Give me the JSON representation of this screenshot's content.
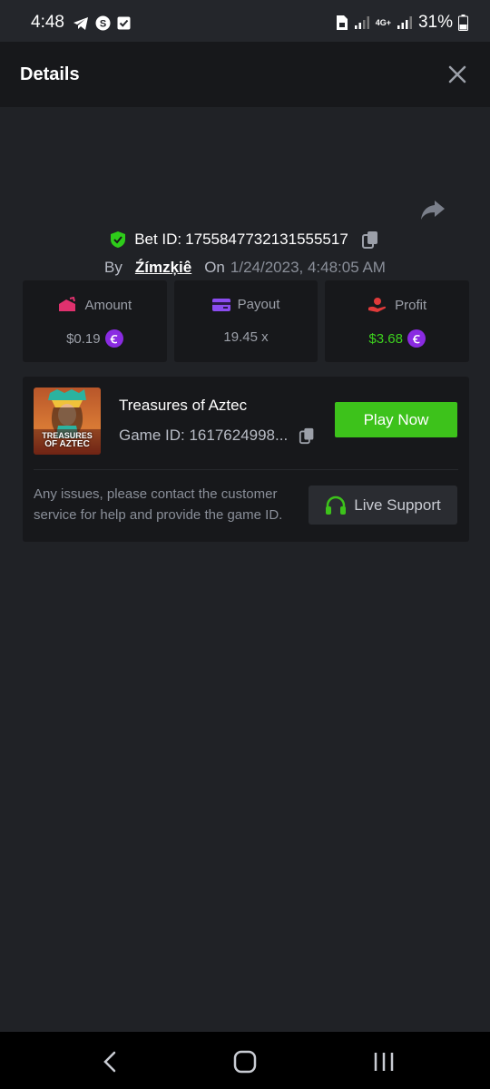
{
  "status_bar": {
    "time": "4:48",
    "battery": "31%",
    "network": "4G+"
  },
  "header": {
    "title": "Details"
  },
  "bet": {
    "id_label": "Bet ID:",
    "id": "1755847732131555517",
    "by_label": "By",
    "username": "Źímzķiê",
    "on_label": "On",
    "date": "1/24/2023, 4:48:05 AM"
  },
  "stats": {
    "amount_label": "Amount",
    "amount_value": "$0.19",
    "payout_label": "Payout",
    "payout_value": "19.45 x",
    "profit_label": "Profit",
    "profit_value": "$3.68",
    "coin_symbol": "Ꞓ"
  },
  "game": {
    "name": "Treasures of Aztec",
    "id_text": "Game ID: 1617624998...",
    "thumb_line1": "TREASURES",
    "thumb_line2": "OF AZTEC",
    "play_label": "Play Now"
  },
  "support": {
    "message": "Any issues, please contact the customer service for help and provide the game ID.",
    "button_label": "Live Support"
  },
  "colors": {
    "accent_green": "#3dc21b",
    "profit_green": "#3dd11e",
    "coin_purple": "#8a2be2",
    "amount_pink": "#e0316e",
    "payout_purple": "#8b4cf0",
    "profit_red": "#e03a3a"
  },
  "icons": {
    "share": "share-icon",
    "close": "close-icon",
    "shield": "shield-check-icon",
    "copy": "copy-icon",
    "headset": "headset-icon"
  }
}
